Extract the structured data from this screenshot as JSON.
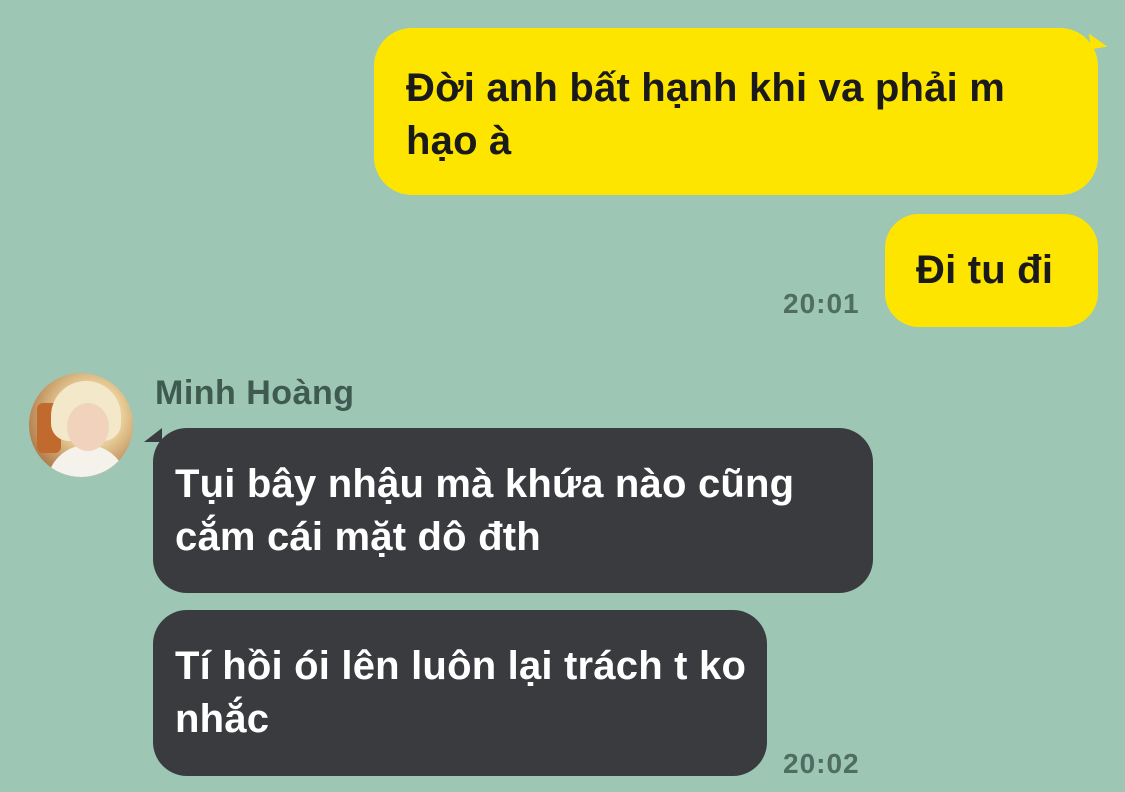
{
  "messages": [
    {
      "side": "outgoing",
      "text": "Đời anh bất hạnh khi va phải m hạo à"
    },
    {
      "side": "outgoing",
      "text": "Đi tu đi",
      "time": "20:01"
    },
    {
      "side": "incoming",
      "sender": "Minh Hoàng",
      "text": "Tụi bây nhậu mà khứa nào cũng cắm cái mặt dô đth"
    },
    {
      "side": "incoming",
      "text": "Tí hồi ói lên luôn lại trách t ko nhắc",
      "time": "20:02"
    }
  ],
  "contact": {
    "name": "Minh Hoàng",
    "avatar_icon": "profile-photo"
  },
  "colors": {
    "background": "#9dc6b4",
    "outgoing_bubble": "#fee500",
    "incoming_bubble": "#3a3b3e",
    "timestamp": "#4f6d62"
  }
}
